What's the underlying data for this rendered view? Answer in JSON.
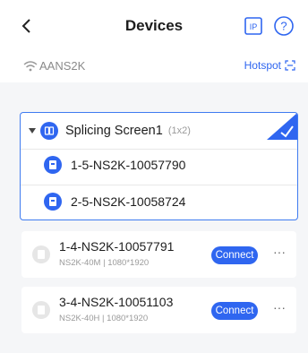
{
  "header": {
    "title": "Devices",
    "back_icon": "back-icon",
    "ip_icon": "ip-icon",
    "help_icon": "help-icon"
  },
  "network": {
    "ssid": "AANS2K",
    "hotspot_label": "Hotspot",
    "wifi_icon": "wifi-icon",
    "scan_icon": "scan-icon"
  },
  "group": {
    "name": "Splicing Screen1",
    "size": "(1x2)",
    "selected": true,
    "accent": "#2f66f0",
    "items": [
      {
        "label": "1-5-NS2K-10057790"
      },
      {
        "label": "2-5-NS2K-10058724"
      }
    ]
  },
  "devices": [
    {
      "name": "1-4-NS2K-10057791",
      "meta": "NS2K-40M  |  1080*1920",
      "action": "Connect",
      "more": "···"
    },
    {
      "name": "3-4-NS2K-10051103",
      "meta": "NS2K-40H  |  1080*1920",
      "action": "Connect",
      "more": "···"
    }
  ]
}
